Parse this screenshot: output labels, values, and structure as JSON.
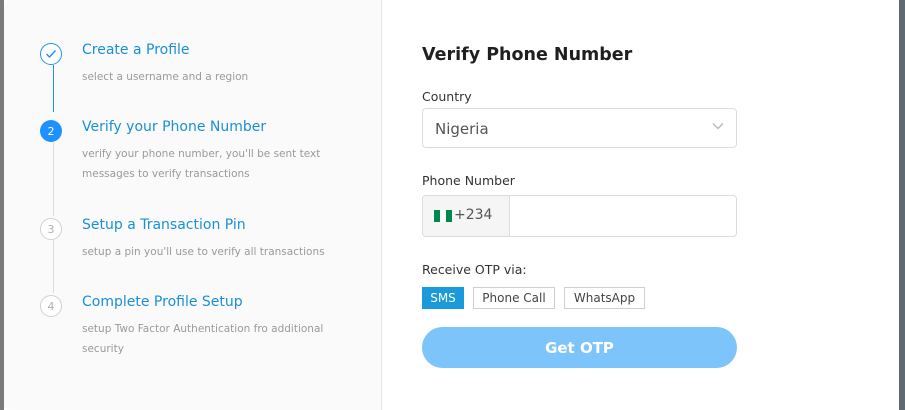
{
  "steps": [
    {
      "number": "",
      "title": "Create a Profile",
      "description": "select a username and a region",
      "state": "done"
    },
    {
      "number": "2",
      "title": "Verify your Phone Number",
      "description": "verify your phone number, you'll be sent text messages to verify transactions",
      "state": "active"
    },
    {
      "number": "3",
      "title": "Setup a Transaction Pin",
      "description": "setup a pin you'll use to verify all transactions",
      "state": "pending"
    },
    {
      "number": "4",
      "title": "Complete Profile Setup",
      "description": "setup Two Factor Authentication fro additional security",
      "state": "pending"
    }
  ],
  "form": {
    "title": "Verify Phone Number",
    "country_label": "Country",
    "country_value": "Nigeria",
    "phone_label": "Phone Number",
    "dial_code": "+234",
    "phone_value": "",
    "otp_label": "Receive OTP via:",
    "otp_options": [
      "SMS",
      "Phone Call",
      "WhatsApp"
    ],
    "otp_selected": "SMS",
    "submit_label": "Get OTP"
  },
  "colors": {
    "accent": "#1e90ff",
    "submit_button": "#7cc4fa",
    "selected_option": "#1a9ad8",
    "flag_green": "#008751"
  },
  "icons": {
    "step_done": "check-icon",
    "country_select": "chevron-down-icon",
    "dial_code": "nigeria-flag-icon"
  }
}
